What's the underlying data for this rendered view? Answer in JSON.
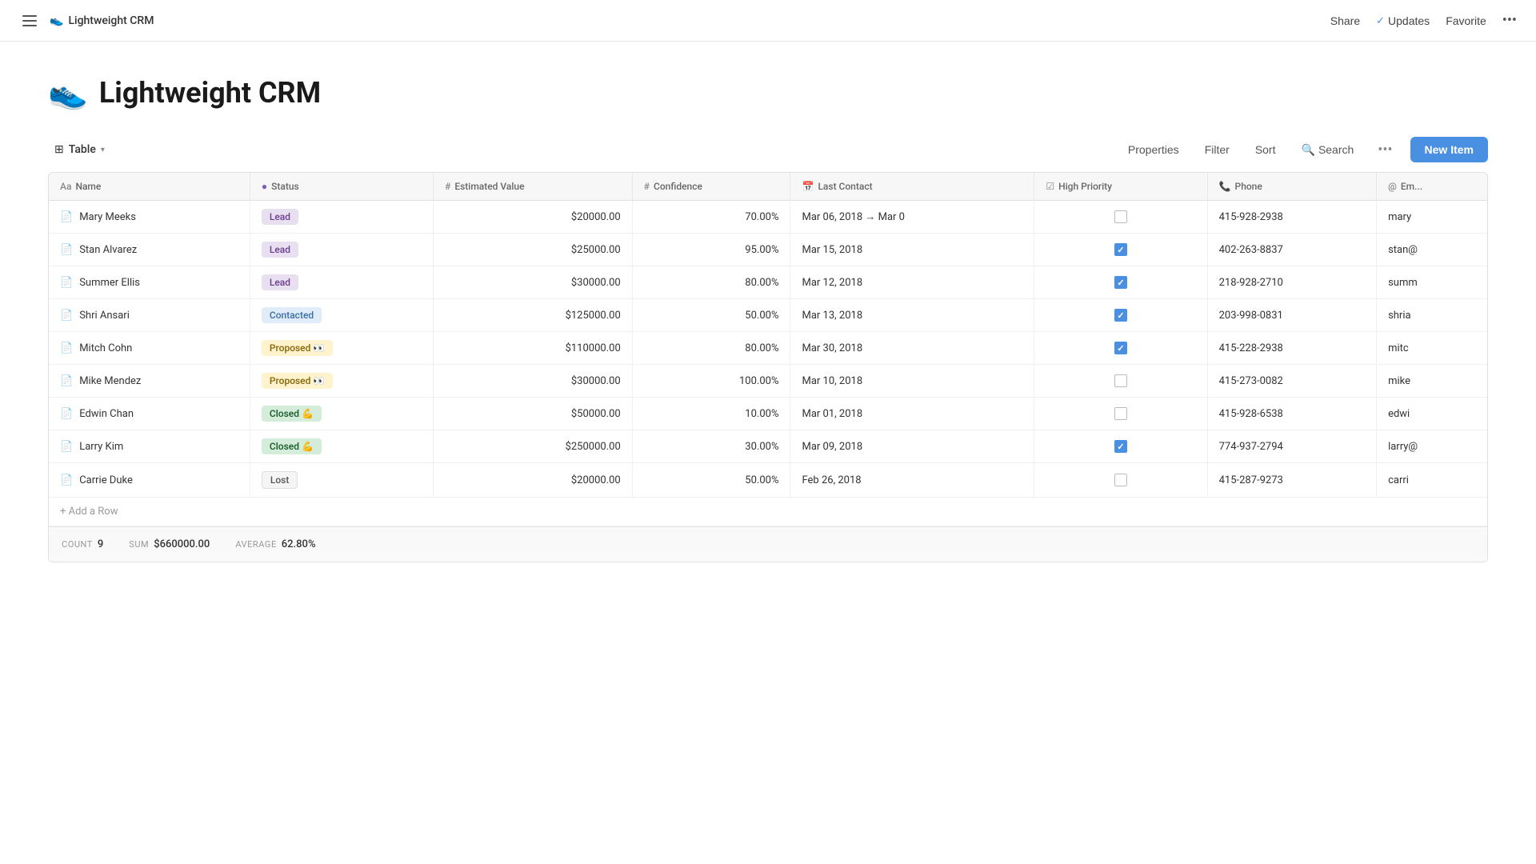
{
  "nav": {
    "title": "Lightweight CRM",
    "emoji": "👟",
    "share": "Share",
    "updates": "Updates",
    "favorite": "Favorite"
  },
  "page": {
    "emoji": "👟",
    "title": "Lightweight CRM"
  },
  "toolbar": {
    "view_label": "Table",
    "properties": "Properties",
    "filter": "Filter",
    "sort": "Sort",
    "search": "Search",
    "new_item": "New Item"
  },
  "columns": [
    {
      "id": "name",
      "label": "Name",
      "icon": "Aa"
    },
    {
      "id": "status",
      "label": "Status",
      "icon": "●"
    },
    {
      "id": "estimated_value",
      "label": "Estimated Value",
      "icon": "#"
    },
    {
      "id": "confidence",
      "label": "Confidence",
      "icon": "#"
    },
    {
      "id": "last_contact",
      "label": "Last Contact",
      "icon": "📅"
    },
    {
      "id": "high_priority",
      "label": "High Priority",
      "icon": "☑"
    },
    {
      "id": "phone",
      "label": "Phone",
      "icon": "📞"
    },
    {
      "id": "email",
      "label": "Em..."
    }
  ],
  "rows": [
    {
      "name": "Mary Meeks",
      "status": "Lead",
      "status_type": "lead",
      "estimated_value": "$20000.00",
      "confidence": "70.00%",
      "last_contact": "Mar 06, 2018 → Mar 0",
      "high_priority": false,
      "phone": "415-928-2938",
      "email": "mary"
    },
    {
      "name": "Stan Alvarez",
      "status": "Lead",
      "status_type": "lead",
      "estimated_value": "$25000.00",
      "confidence": "95.00%",
      "last_contact": "Mar 15, 2018",
      "high_priority": true,
      "phone": "402-263-8837",
      "email": "stan@"
    },
    {
      "name": "Summer Ellis",
      "status": "Lead",
      "status_type": "lead",
      "estimated_value": "$30000.00",
      "confidence": "80.00%",
      "last_contact": "Mar 12, 2018",
      "high_priority": true,
      "phone": "218-928-2710",
      "email": "summ"
    },
    {
      "name": "Shri Ansari",
      "status": "Contacted",
      "status_type": "contacted",
      "estimated_value": "$125000.00",
      "confidence": "50.00%",
      "last_contact": "Mar 13, 2018",
      "high_priority": true,
      "phone": "203-998-0831",
      "email": "shria"
    },
    {
      "name": "Mitch Cohn",
      "status": "Proposed 👀",
      "status_type": "proposed",
      "estimated_value": "$110000.00",
      "confidence": "80.00%",
      "last_contact": "Mar 30, 2018",
      "high_priority": true,
      "phone": "415-228-2938",
      "email": "mitc"
    },
    {
      "name": "Mike Mendez",
      "status": "Proposed 👀",
      "status_type": "proposed",
      "estimated_value": "$30000.00",
      "confidence": "100.00%",
      "last_contact": "Mar 10, 2018",
      "high_priority": false,
      "phone": "415-273-0082",
      "email": "mike"
    },
    {
      "name": "Edwin Chan",
      "status": "Closed 💪",
      "status_type": "closed",
      "estimated_value": "$50000.00",
      "confidence": "10.00%",
      "last_contact": "Mar 01, 2018",
      "high_priority": false,
      "phone": "415-928-6538",
      "email": "edwi"
    },
    {
      "name": "Larry Kim",
      "status": "Closed 💪",
      "status_type": "closed",
      "estimated_value": "$250000.00",
      "confidence": "30.00%",
      "last_contact": "Mar 09, 2018",
      "high_priority": true,
      "phone": "774-937-2794",
      "email": "larry@"
    },
    {
      "name": "Carrie Duke",
      "status": "Lost",
      "status_type": "lost",
      "estimated_value": "$20000.00",
      "confidence": "50.00%",
      "last_contact": "Feb 26, 2018",
      "high_priority": false,
      "phone": "415-287-9273",
      "email": "carri"
    }
  ],
  "add_row_label": "+ Add a Row",
  "footer": {
    "count_label": "COUNT",
    "count_value": "9",
    "sum_label": "SUM",
    "sum_value": "$660000.00",
    "avg_label": "AVERAGE",
    "avg_value": "62.80%"
  }
}
